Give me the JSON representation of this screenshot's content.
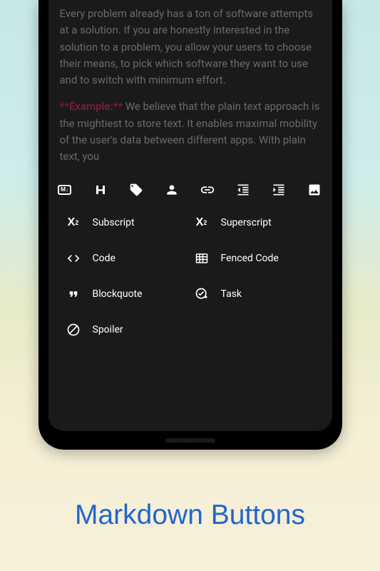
{
  "caption": "Markdown Buttons",
  "content": {
    "paragraph1": "Every problem already has a ton of software attempts at a solution. If you are honestly interested in the solution to a problem, you allow your users to choose their means, to pick which software they want to use and to switch with minimum effort.",
    "exampleLabel": "**Example:**",
    "paragraph2": " We believe that the plain text approach is the mightiest to store text. It enables maximal mobility of the user's data between different apps. With plain text, you"
  },
  "toolbar": {
    "icons": {
      "markdown": "M↓",
      "heading": "H",
      "tag": "tag",
      "person": "person",
      "link": "link",
      "outdent": "outdent",
      "indent": "indent",
      "image": "image"
    }
  },
  "menu": {
    "subscript": "Subscript",
    "superscript": "Superscript",
    "code": "Code",
    "fencedCode": "Fenced Code",
    "blockquote": "Blockquote",
    "task": "Task",
    "spoiler": "Spoiler"
  }
}
